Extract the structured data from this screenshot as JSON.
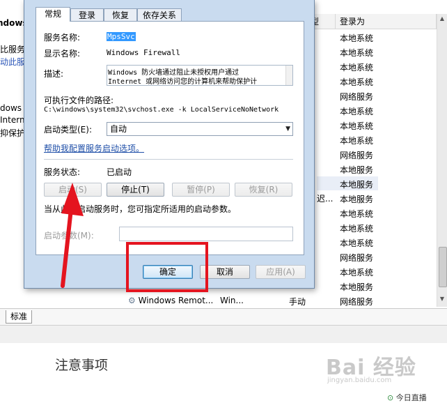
{
  "background": {
    "left_fragments": [
      "ndows",
      "比服务",
      "动此服",
      "dows",
      "Intern",
      "抑保护"
    ],
    "column_header_type": "型",
    "column_header_logon": "登录为",
    "logon_values": [
      "本地系统",
      "本地系统",
      "本地系统",
      "本地系统",
      "网络服务",
      "本地系统",
      "本地系统",
      "本地系统",
      "网络服务",
      "本地服务",
      "本地服务",
      "本地服务",
      "本地系统",
      "本地系统",
      "本地系统",
      "网络服务",
      "本地系统",
      "本地服务",
      "网络服务"
    ],
    "fragment_chi": "迟...",
    "bottom_row": {
      "name": "Windows Remot...",
      "desc": "Win...",
      "startup": "手动"
    },
    "tab_standard": "标准"
  },
  "dialog": {
    "tabs": [
      "常规",
      "登录",
      "恢复",
      "依存关系"
    ],
    "active_tab": 0,
    "service_name_label": "服务名称:",
    "service_name_value": "MpsSvc",
    "display_name_label": "显示名称:",
    "display_name_value": "Windows Firewall",
    "description_label": "描述:",
    "description_line1": "Windows 防火墙通过阻止未授权用户通过",
    "description_line2": "Internet 或网络访问您的计算机来帮助保护计",
    "exe_path_label": "可执行文件的路径:",
    "exe_path_value": "C:\\windows\\system32\\svchost.exe -k LocalServiceNoNetwork",
    "startup_type_label": "启动类型(E):",
    "startup_type_value": "自动",
    "help_link": "帮助我配置服务启动选项。",
    "service_status_label": "服务状态:",
    "service_status_value": "已启动",
    "buttons": {
      "start": "启动(S)",
      "stop": "停止(T)",
      "pause": "暂停(P)",
      "resume": "恢复(R)"
    },
    "start_hint": "当从此处启动服务时，您可指定所适用的启动参数。",
    "start_params_label": "启动参数(M):",
    "ok": "确定",
    "cancel": "取消",
    "apply": "应用(A)"
  },
  "article": {
    "notes_title": "注意事项",
    "watermark": "Bai 经验",
    "watermark_sub": "jingyan.baidu.com",
    "live_chip": "今日直播"
  },
  "colors": {
    "annotation": "#e4141f",
    "dialog_frame": "#c9dbef",
    "link": "#1f4fa8"
  }
}
